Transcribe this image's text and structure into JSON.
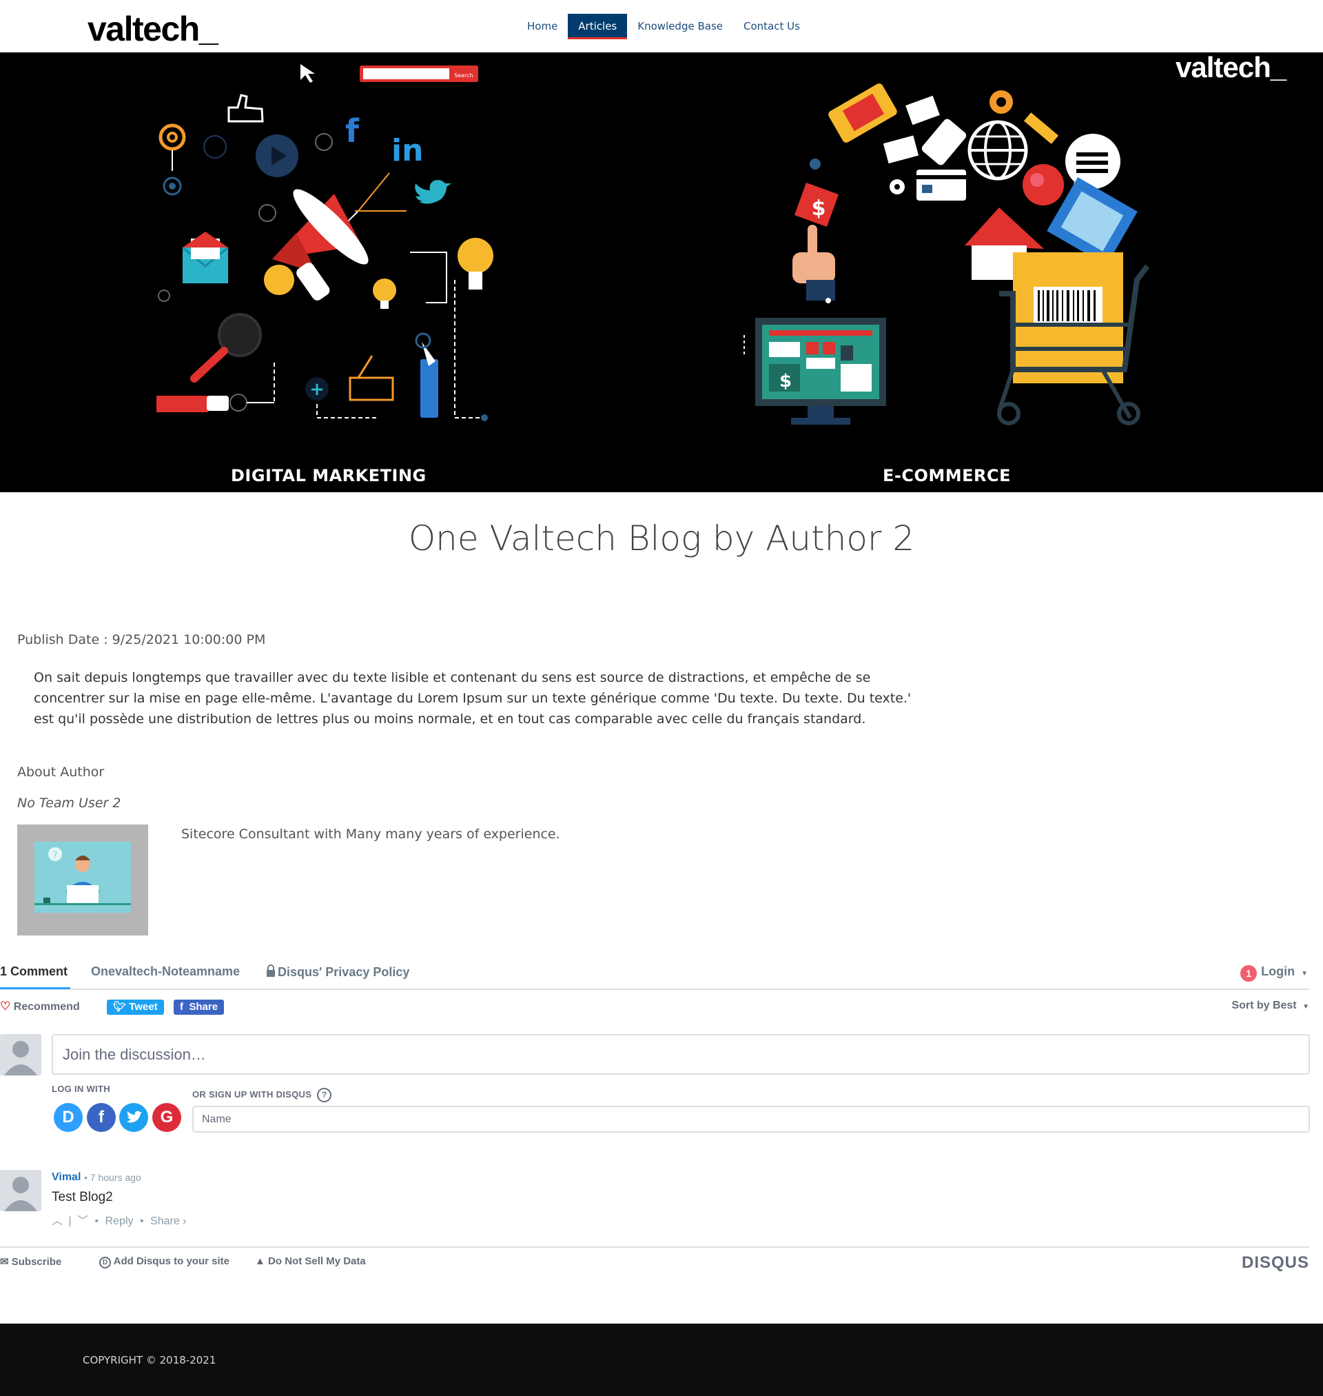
{
  "header": {
    "logo": "valtech_",
    "nav": [
      {
        "label": "Home",
        "active": false
      },
      {
        "label": "Articles",
        "active": true
      },
      {
        "label": "Knowledge Base",
        "active": false
      },
      {
        "label": "Contact Us",
        "active": false
      }
    ]
  },
  "hero": {
    "logo": "valtech_",
    "left_caption": "DIGITAL MARKETING",
    "right_caption": "E-COMMERCE",
    "search_button": "Search",
    "colors": {
      "background": "#000000",
      "red": "#e0322e",
      "yellow": "#f6b92e",
      "teal": "#2bb3c9"
    }
  },
  "article": {
    "title": "One Valtech Blog by Author 2",
    "publish_date": "Publish Date : 9/25/2021 10:00:00 PM",
    "body_lines": [
      "On sait depuis longtemps que travailler avec du texte lisible et contenant du sens est source de distractions, et empêche de se",
      "concentrer sur la mise en page elle-même. L'avantage du Lorem Ipsum sur un texte générique comme 'Du texte. Du texte. Du texte.'",
      "est qu'il possède une distribution de lettres plus ou moins normale, et en tout cas comparable avec celle du français standard."
    ],
    "about_heading": "About Author",
    "author_name": "No Team User 2",
    "author_bio": "Sitecore Consultant with Many many years of experience."
  },
  "disqus": {
    "tabs": {
      "comments": "1 Comment",
      "community": "Onevaltech-Noteamname",
      "privacy": "Disqus' Privacy Policy",
      "login": "Login",
      "login_badge": "1"
    },
    "recommend": "Recommend",
    "tweet": "Tweet",
    "share": "Share",
    "sort": "Sort by Best",
    "join_placeholder": "Join the discussion…",
    "log_in_with": "LOG IN WITH",
    "sign_up": "OR SIGN UP WITH DISQUS",
    "help_icon": "?",
    "name_placeholder": "Name",
    "social": [
      "D",
      "f",
      "t",
      "G"
    ],
    "comment": {
      "author": "Vimal",
      "time": "• 7 hours ago",
      "text": "Test Blog2",
      "reply": "Reply",
      "share": "Share ›"
    },
    "footer": {
      "subscribe": "Subscribe",
      "add": "Add Disqus to your site",
      "dnsmd": "Do Not Sell My Data",
      "brand": "DISQUS"
    },
    "colors": {
      "blue": "#2e9fff",
      "twitter": "#1da1f2",
      "facebook": "#3b65c4",
      "google": "#dd2c39",
      "disqus": "#2e9fff"
    }
  },
  "footer": {
    "copyright": "COPYRIGHT © 2018-2021"
  }
}
